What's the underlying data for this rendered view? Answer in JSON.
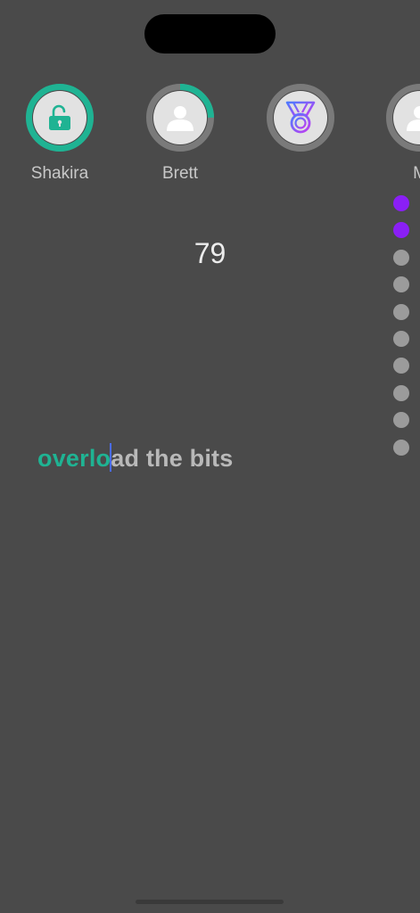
{
  "players": [
    {
      "name": "Shakira",
      "icon": "unlocked-lock-icon",
      "progress": 1.0,
      "status": "unlocked"
    },
    {
      "name": "Brett",
      "icon": "user-icon",
      "progress": 0.25,
      "status": "in-progress"
    },
    {
      "name": "",
      "icon": "medal-icon",
      "progress": 0.0,
      "status": "locked"
    },
    {
      "name": "M",
      "icon": "user-icon",
      "progress": 0.0,
      "status": "locked"
    }
  ],
  "score": "79",
  "progress_dots": {
    "completed": 2,
    "total": 10
  },
  "typing": {
    "typed": "overlo",
    "remaining": "ad the bits"
  },
  "colors": {
    "background": "#4a4a4a",
    "accent_green": "#1fb393",
    "accent_purple": "#8a1ff5",
    "dot_inactive": "#9b9b9b",
    "caret": "#4a6cf7",
    "ring_track": "#7a7a7a"
  }
}
